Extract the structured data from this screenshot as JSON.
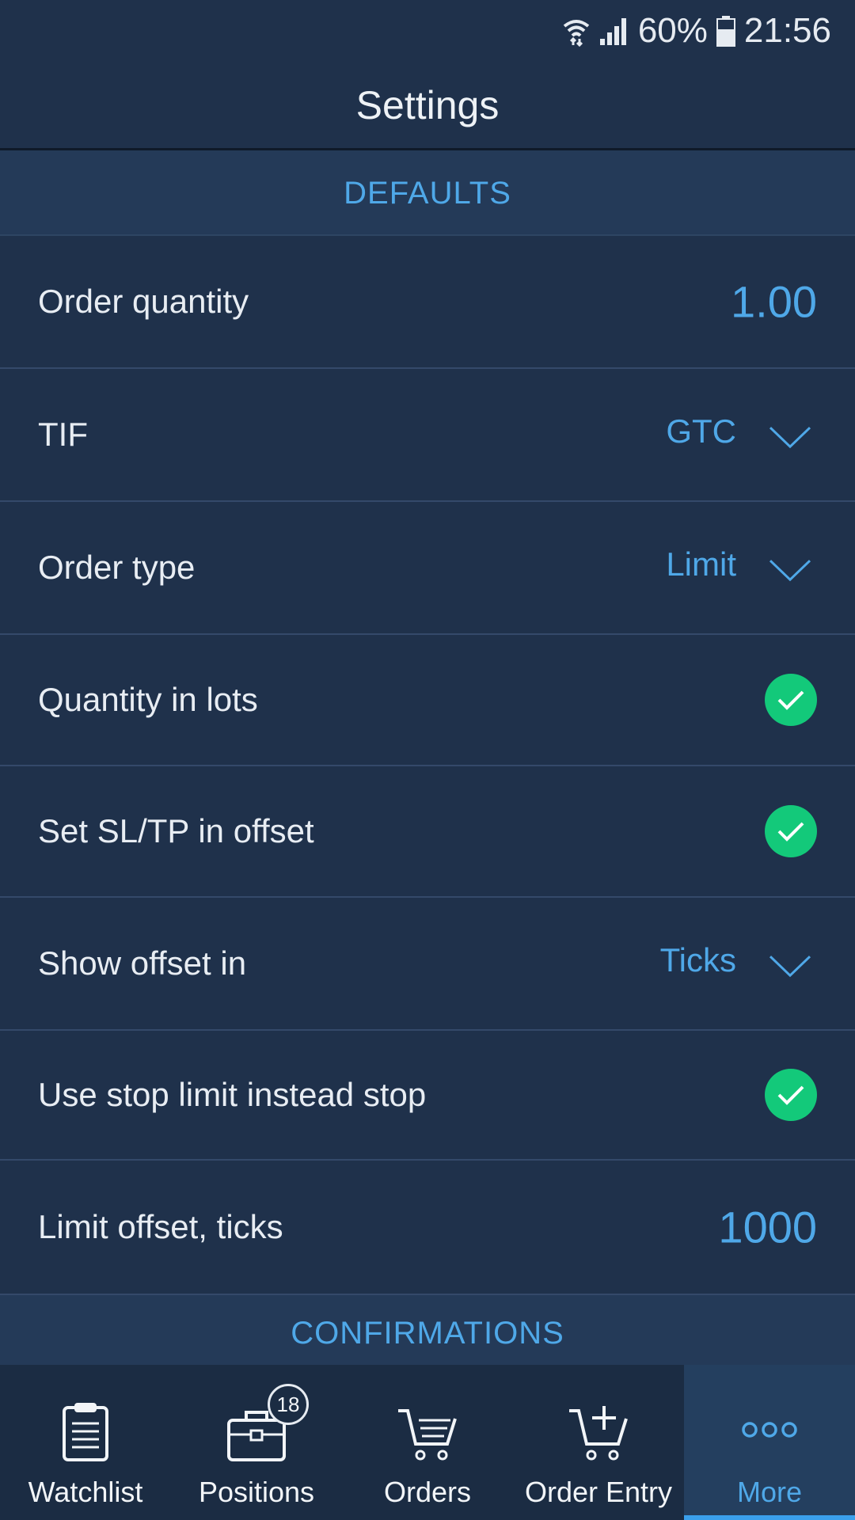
{
  "status_bar": {
    "battery": "60%",
    "time": "21:56",
    "icons": [
      "wifi-icon",
      "signal-icon",
      "battery-icon"
    ]
  },
  "header": {
    "title": "Settings"
  },
  "sections": {
    "defaults": "DEFAULTS",
    "confirmations": "CONFIRMATIONS"
  },
  "settings": {
    "order_quantity": {
      "label": "Order quantity",
      "value": "1.00"
    },
    "tif": {
      "label": "TIF",
      "value": "GTC"
    },
    "order_type": {
      "label": "Order type",
      "value": "Limit"
    },
    "quantity_in_lots": {
      "label": "Quantity in lots",
      "checked": true
    },
    "sl_tp_offset": {
      "label": "Set SL/TP in offset",
      "checked": true
    },
    "show_offset_in": {
      "label": "Show offset in",
      "value": "Ticks"
    },
    "stop_limit": {
      "label": "Use stop limit instead stop",
      "checked": true
    },
    "limit_offset": {
      "label": "Limit offset, ticks",
      "value": "1000"
    }
  },
  "tabs": {
    "watchlist": {
      "label": "Watchlist",
      "icon": "clipboard-icon"
    },
    "positions": {
      "label": "Positions",
      "icon": "briefcase-icon",
      "badge": "18"
    },
    "orders": {
      "label": "Orders",
      "icon": "cart-icon"
    },
    "order_entry": {
      "label": "Order Entry",
      "icon": "cart-plus-icon"
    },
    "more": {
      "label": "More",
      "icon": "more-dots-icon",
      "active": true
    }
  },
  "colors": {
    "background": "#1f314b",
    "accent": "#4fa8e8",
    "check": "#13c97a",
    "section_header": "#243a58"
  }
}
